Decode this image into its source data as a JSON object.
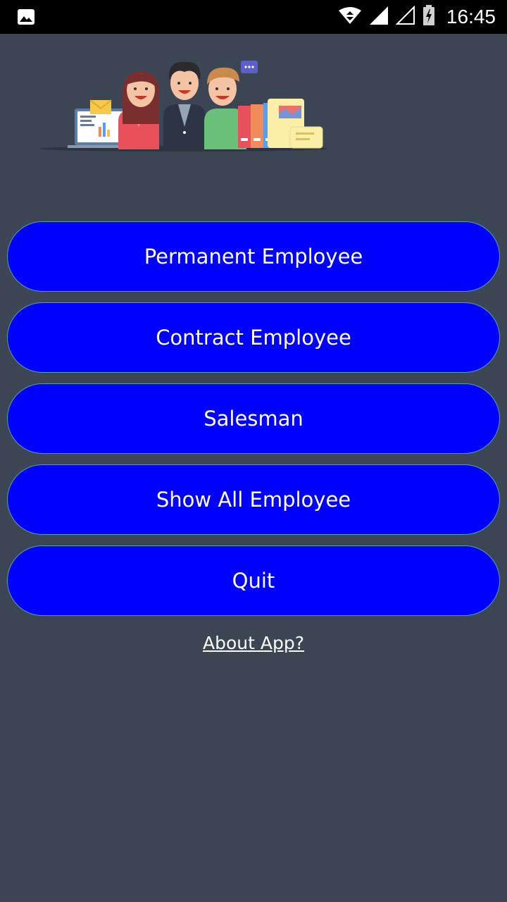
{
  "status_bar": {
    "time": "16:45",
    "icons": [
      "image-notification-icon",
      "wifi-icon",
      "signal-full-icon",
      "signal-empty-icon",
      "battery-charging-icon"
    ]
  },
  "header": {
    "illustration": "team-illustration"
  },
  "menu": {
    "buttons": [
      {
        "label": "Permanent Employee"
      },
      {
        "label": "Contract Employee"
      },
      {
        "label": "Salesman"
      },
      {
        "label": "Show All Employee"
      },
      {
        "label": "Quit"
      }
    ]
  },
  "about_link": "About App?",
  "colors": {
    "background": "#3b4553",
    "button": "#0000ff",
    "button_border": "#4fa3a8",
    "text": "#ffffff"
  }
}
